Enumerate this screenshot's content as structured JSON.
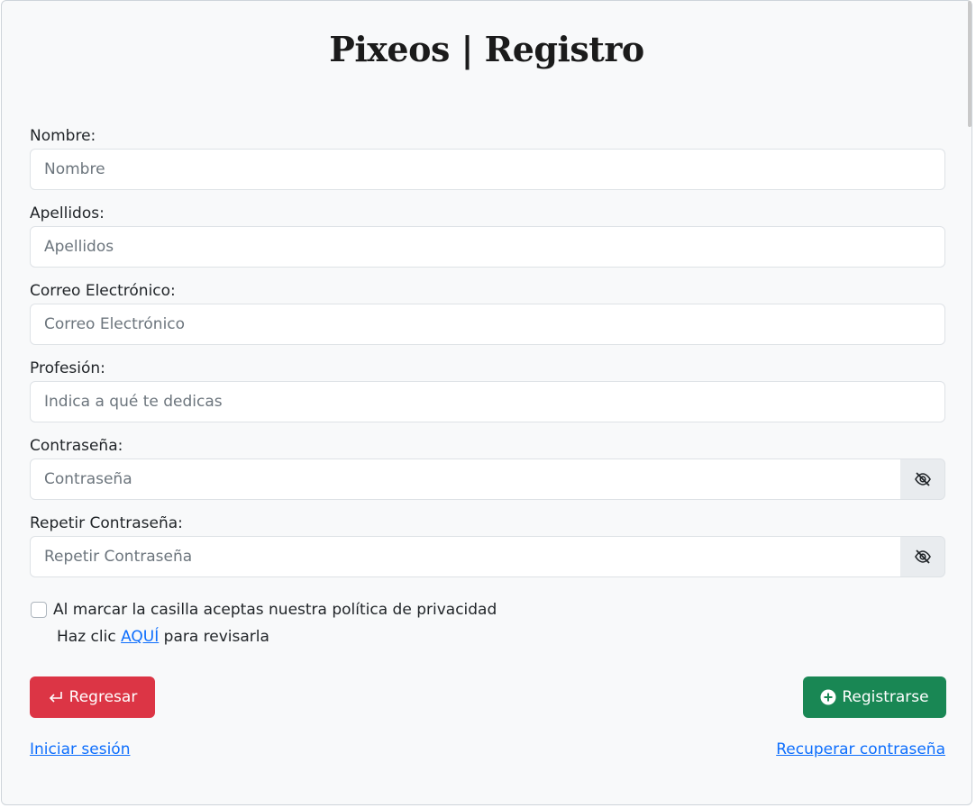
{
  "title": "Pixeos | Registro",
  "form": {
    "nombre": {
      "label": "Nombre:",
      "placeholder": "Nombre"
    },
    "apellidos": {
      "label": "Apellidos:",
      "placeholder": "Apellidos"
    },
    "correo": {
      "label": "Correo Electrónico:",
      "placeholder": "Correo Electrónico"
    },
    "profesion": {
      "label": "Profesión:",
      "placeholder": "Indica a qué te dedicas"
    },
    "contrasena": {
      "label": "Contraseña:",
      "placeholder": "Contraseña",
      "toggle_icon": "eye-slash-icon"
    },
    "repetir": {
      "label": "Repetir Contraseña:",
      "placeholder": "Repetir Contraseña",
      "toggle_icon": "eye-slash-icon"
    }
  },
  "consent": {
    "checked": false,
    "text": "Al marcar la casilla aceptas nuestra política de privacidad",
    "prefix": "Haz clic ",
    "link": "AQUÍ",
    "suffix": " para revisarla"
  },
  "buttons": {
    "back": {
      "label": "Regresar",
      "icon": "return-arrow-icon",
      "color": "#dc3545"
    },
    "register": {
      "label": "Registrarse",
      "icon": "plus-circle-icon",
      "color": "#198754"
    }
  },
  "links": {
    "login": "Iniciar sesión",
    "recover": "Recuperar contraseña"
  }
}
